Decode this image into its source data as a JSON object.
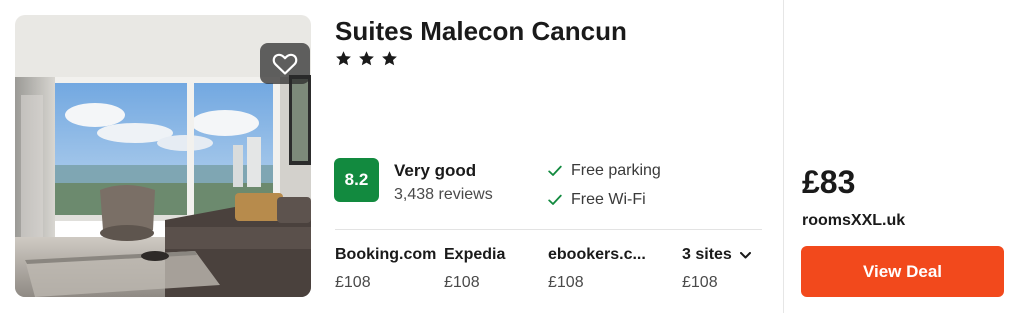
{
  "hotel": {
    "name": "Suites Malecon Cancun",
    "star_count": 3,
    "stars_text": "★★★"
  },
  "rating": {
    "score": "8.2",
    "label": "Very good",
    "reviews": "3,438 reviews",
    "badge_color": "#128a3f"
  },
  "amenities": [
    {
      "label": "Free parking",
      "icon": "check-icon"
    },
    {
      "label": "Free Wi-Fi",
      "icon": "check-icon"
    }
  ],
  "sites": [
    {
      "name": "Booking.com",
      "price": "£108"
    },
    {
      "name": "Expedia",
      "price": "£108"
    },
    {
      "name": "ebookers.c...",
      "price": "£108"
    },
    {
      "name": "3 sites",
      "price": "£108",
      "icon": "chevron-down-icon"
    }
  ],
  "deal": {
    "price": "£83",
    "provider": "roomsXXL.uk",
    "button_label": "View Deal",
    "button_color": "#f2491c"
  },
  "photo": {
    "description_icon": "hotel-room-photo",
    "favorite_icon": "heart-icon"
  }
}
